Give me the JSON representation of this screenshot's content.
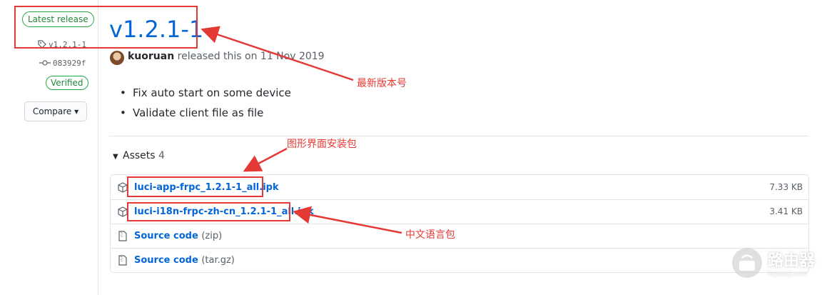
{
  "sidebar": {
    "latest_badge": "Latest release",
    "tag": "v1.2.1-1",
    "commit": "083929f",
    "verified": "Verified",
    "compare": "Compare ▾"
  },
  "release": {
    "title": "v1.2.1-1",
    "author": "kuoruan",
    "released_text": "released this on 11 Nov 2019",
    "notes": [
      "Fix auto start on some device",
      "Validate client file as file"
    ]
  },
  "assets": {
    "heading": "Assets",
    "count": "4",
    "items": [
      {
        "name": "luci-app-frpc_1.2.1-1_all.ipk",
        "size": "7.33 KB",
        "icon": "package-icon"
      },
      {
        "name": "luci-i18n-frpc-zh-cn_1.2.1-1_all.ipk",
        "size": "3.41 KB",
        "icon": "package-icon"
      },
      {
        "name": "Source code",
        "ext": "(zip)",
        "icon": "file-zip-icon"
      },
      {
        "name": "Source code",
        "ext": "(tar.gz)",
        "icon": "file-zip-icon"
      }
    ]
  },
  "annotations": {
    "latest_version": "最新版本号",
    "gui_package": "图形界面安装包",
    "lang_package": "中文语言包",
    "color": "#e53935"
  },
  "watermark": {
    "text": "路由器",
    "sub": "luyouqi.com"
  },
  "colors": {
    "link": "#0366d6",
    "green": "#28a745",
    "muted": "#586069"
  }
}
